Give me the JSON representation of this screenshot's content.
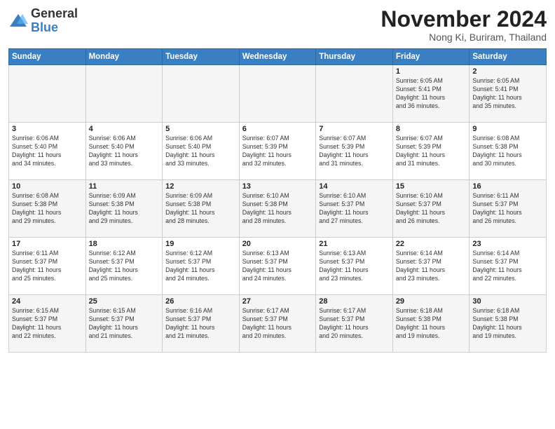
{
  "logo": {
    "general": "General",
    "blue": "Blue"
  },
  "header": {
    "month": "November 2024",
    "location": "Nong Ki, Buriram, Thailand"
  },
  "weekdays": [
    "Sunday",
    "Monday",
    "Tuesday",
    "Wednesday",
    "Thursday",
    "Friday",
    "Saturday"
  ],
  "weeks": [
    [
      {
        "day": "",
        "info": ""
      },
      {
        "day": "",
        "info": ""
      },
      {
        "day": "",
        "info": ""
      },
      {
        "day": "",
        "info": ""
      },
      {
        "day": "",
        "info": ""
      },
      {
        "day": "1",
        "info": "Sunrise: 6:05 AM\nSunset: 5:41 PM\nDaylight: 11 hours\nand 36 minutes."
      },
      {
        "day": "2",
        "info": "Sunrise: 6:05 AM\nSunset: 5:41 PM\nDaylight: 11 hours\nand 35 minutes."
      }
    ],
    [
      {
        "day": "3",
        "info": "Sunrise: 6:06 AM\nSunset: 5:40 PM\nDaylight: 11 hours\nand 34 minutes."
      },
      {
        "day": "4",
        "info": "Sunrise: 6:06 AM\nSunset: 5:40 PM\nDaylight: 11 hours\nand 33 minutes."
      },
      {
        "day": "5",
        "info": "Sunrise: 6:06 AM\nSunset: 5:40 PM\nDaylight: 11 hours\nand 33 minutes."
      },
      {
        "day": "6",
        "info": "Sunrise: 6:07 AM\nSunset: 5:39 PM\nDaylight: 11 hours\nand 32 minutes."
      },
      {
        "day": "7",
        "info": "Sunrise: 6:07 AM\nSunset: 5:39 PM\nDaylight: 11 hours\nand 31 minutes."
      },
      {
        "day": "8",
        "info": "Sunrise: 6:07 AM\nSunset: 5:39 PM\nDaylight: 11 hours\nand 31 minutes."
      },
      {
        "day": "9",
        "info": "Sunrise: 6:08 AM\nSunset: 5:38 PM\nDaylight: 11 hours\nand 30 minutes."
      }
    ],
    [
      {
        "day": "10",
        "info": "Sunrise: 6:08 AM\nSunset: 5:38 PM\nDaylight: 11 hours\nand 29 minutes."
      },
      {
        "day": "11",
        "info": "Sunrise: 6:09 AM\nSunset: 5:38 PM\nDaylight: 11 hours\nand 29 minutes."
      },
      {
        "day": "12",
        "info": "Sunrise: 6:09 AM\nSunset: 5:38 PM\nDaylight: 11 hours\nand 28 minutes."
      },
      {
        "day": "13",
        "info": "Sunrise: 6:10 AM\nSunset: 5:38 PM\nDaylight: 11 hours\nand 28 minutes."
      },
      {
        "day": "14",
        "info": "Sunrise: 6:10 AM\nSunset: 5:37 PM\nDaylight: 11 hours\nand 27 minutes."
      },
      {
        "day": "15",
        "info": "Sunrise: 6:10 AM\nSunset: 5:37 PM\nDaylight: 11 hours\nand 26 minutes."
      },
      {
        "day": "16",
        "info": "Sunrise: 6:11 AM\nSunset: 5:37 PM\nDaylight: 11 hours\nand 26 minutes."
      }
    ],
    [
      {
        "day": "17",
        "info": "Sunrise: 6:11 AM\nSunset: 5:37 PM\nDaylight: 11 hours\nand 25 minutes."
      },
      {
        "day": "18",
        "info": "Sunrise: 6:12 AM\nSunset: 5:37 PM\nDaylight: 11 hours\nand 25 minutes."
      },
      {
        "day": "19",
        "info": "Sunrise: 6:12 AM\nSunset: 5:37 PM\nDaylight: 11 hours\nand 24 minutes."
      },
      {
        "day": "20",
        "info": "Sunrise: 6:13 AM\nSunset: 5:37 PM\nDaylight: 11 hours\nand 24 minutes."
      },
      {
        "day": "21",
        "info": "Sunrise: 6:13 AM\nSunset: 5:37 PM\nDaylight: 11 hours\nand 23 minutes."
      },
      {
        "day": "22",
        "info": "Sunrise: 6:14 AM\nSunset: 5:37 PM\nDaylight: 11 hours\nand 23 minutes."
      },
      {
        "day": "23",
        "info": "Sunrise: 6:14 AM\nSunset: 5:37 PM\nDaylight: 11 hours\nand 22 minutes."
      }
    ],
    [
      {
        "day": "24",
        "info": "Sunrise: 6:15 AM\nSunset: 5:37 PM\nDaylight: 11 hours\nand 22 minutes."
      },
      {
        "day": "25",
        "info": "Sunrise: 6:15 AM\nSunset: 5:37 PM\nDaylight: 11 hours\nand 21 minutes."
      },
      {
        "day": "26",
        "info": "Sunrise: 6:16 AM\nSunset: 5:37 PM\nDaylight: 11 hours\nand 21 minutes."
      },
      {
        "day": "27",
        "info": "Sunrise: 6:17 AM\nSunset: 5:37 PM\nDaylight: 11 hours\nand 20 minutes."
      },
      {
        "day": "28",
        "info": "Sunrise: 6:17 AM\nSunset: 5:37 PM\nDaylight: 11 hours\nand 20 minutes."
      },
      {
        "day": "29",
        "info": "Sunrise: 6:18 AM\nSunset: 5:38 PM\nDaylight: 11 hours\nand 19 minutes."
      },
      {
        "day": "30",
        "info": "Sunrise: 6:18 AM\nSunset: 5:38 PM\nDaylight: 11 hours\nand 19 minutes."
      }
    ]
  ]
}
